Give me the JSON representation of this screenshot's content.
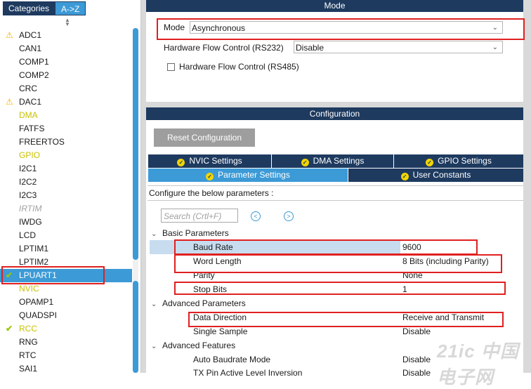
{
  "left_panel": {
    "tabs": [
      {
        "label": "Categories",
        "active": false
      },
      {
        "label": "A->Z",
        "active": true
      }
    ],
    "peripherals": [
      {
        "name": "ADC1",
        "icon": "warning",
        "style": "normal"
      },
      {
        "name": "CAN1",
        "icon": "",
        "style": "normal"
      },
      {
        "name": "COMP1",
        "icon": "",
        "style": "normal"
      },
      {
        "name": "COMP2",
        "icon": "",
        "style": "normal"
      },
      {
        "name": "CRC",
        "icon": "",
        "style": "normal"
      },
      {
        "name": "DAC1",
        "icon": "warning",
        "style": "normal"
      },
      {
        "name": "DMA",
        "icon": "",
        "style": "yellow"
      },
      {
        "name": "FATFS",
        "icon": "",
        "style": "normal"
      },
      {
        "name": "FREERTOS",
        "icon": "",
        "style": "normal"
      },
      {
        "name": "GPIO",
        "icon": "",
        "style": "yellow"
      },
      {
        "name": "I2C1",
        "icon": "",
        "style": "normal"
      },
      {
        "name": "I2C2",
        "icon": "",
        "style": "normal"
      },
      {
        "name": "I2C3",
        "icon": "",
        "style": "normal"
      },
      {
        "name": "IRTIM",
        "icon": "",
        "style": "disabled"
      },
      {
        "name": "IWDG",
        "icon": "",
        "style": "normal"
      },
      {
        "name": "LCD",
        "icon": "",
        "style": "normal"
      },
      {
        "name": "LPTIM1",
        "icon": "",
        "style": "normal"
      },
      {
        "name": "LPTIM2",
        "icon": "",
        "style": "normal"
      },
      {
        "name": "LPUART1",
        "icon": "check",
        "style": "selected"
      },
      {
        "name": "NVIC",
        "icon": "",
        "style": "yellow"
      },
      {
        "name": "OPAMP1",
        "icon": "",
        "style": "normal"
      },
      {
        "name": "QUADSPI",
        "icon": "",
        "style": "normal"
      },
      {
        "name": "RCC",
        "icon": "check",
        "style": "yellow"
      },
      {
        "name": "RNG",
        "icon": "",
        "style": "normal"
      },
      {
        "name": "RTC",
        "icon": "",
        "style": "normal"
      },
      {
        "name": "SAI1",
        "icon": "",
        "style": "normal"
      }
    ]
  },
  "mode_section": {
    "header": "Mode",
    "mode_label": "Mode",
    "mode_value": "Asynchronous",
    "hfc232_label": "Hardware Flow Control (RS232)",
    "hfc232_value": "Disable",
    "hfc485_label": "Hardware Flow Control (RS485)",
    "hfc485_checked": false
  },
  "configuration": {
    "header": "Configuration",
    "reset_label": "Reset Configuration",
    "tabs_row1": [
      {
        "label": "NVIC Settings",
        "active": false
      },
      {
        "label": "DMA Settings",
        "active": false
      },
      {
        "label": "GPIO Settings",
        "active": false
      }
    ],
    "tabs_row2": [
      {
        "label": "Parameter Settings",
        "active": true
      },
      {
        "label": "User Constants",
        "active": false
      }
    ],
    "hint": "Configure the below parameters :",
    "search_placeholder": "Search (Crtl+F)",
    "groups": [
      {
        "title": "Basic Parameters",
        "params": [
          {
            "name": "Baud Rate",
            "value": "9600",
            "highlighted": true
          },
          {
            "name": "Word Length",
            "value": "8 Bits (including Parity)",
            "highlighted": false
          },
          {
            "name": "Parity",
            "value": "None",
            "highlighted": false
          },
          {
            "name": "Stop Bits",
            "value": "1",
            "highlighted": false
          }
        ]
      },
      {
        "title": "Advanced Parameters",
        "params": [
          {
            "name": "Data Direction",
            "value": "Receive and Transmit",
            "highlighted": false
          },
          {
            "name": "Single Sample",
            "value": "Disable",
            "highlighted": false
          }
        ]
      },
      {
        "title": "Advanced Features",
        "params": [
          {
            "name": "Auto Baudrate Mode",
            "value": "Disable",
            "highlighted": false
          },
          {
            "name": "TX Pin Active Level Inversion",
            "value": "Disable",
            "highlighted": false
          }
        ]
      }
    ]
  },
  "watermark": "21ic 中国电子网",
  "colors": {
    "header_navy": "#1e3a5f",
    "accent_blue": "#3c9ad6",
    "warning_yellow": "#f0b000",
    "check_green": "#9ac800",
    "annotation_red": "#e02020"
  }
}
